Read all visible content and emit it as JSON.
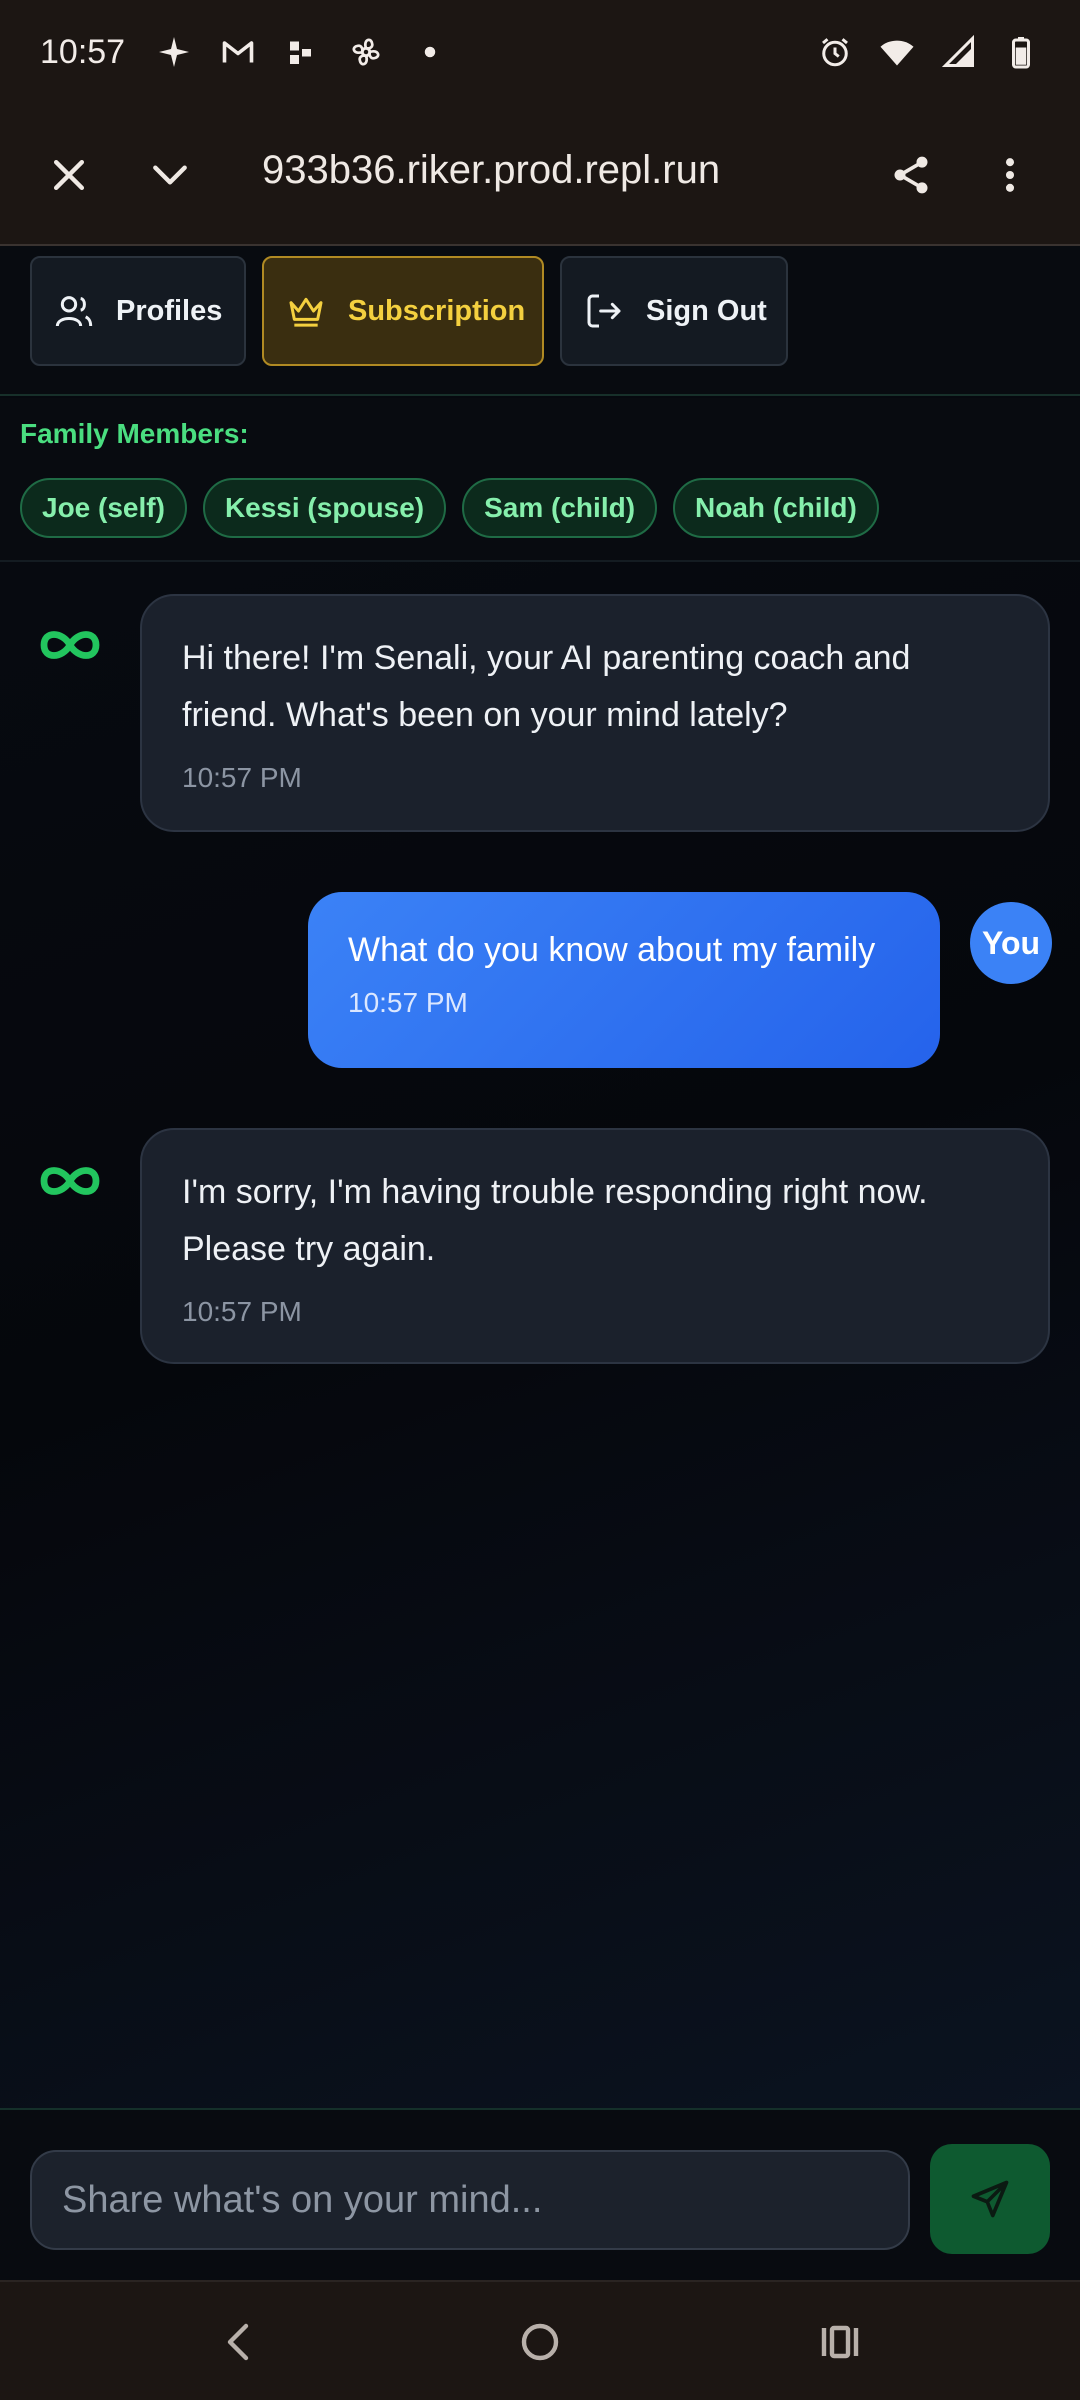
{
  "status_bar": {
    "time": "10:57",
    "left_icons": [
      "sparkle-icon",
      "gmail-icon",
      "dots-icon",
      "fan-icon",
      "dot-icon"
    ],
    "right_icons": [
      "alarm-icon",
      "wifi-icon",
      "signal-icon",
      "battery-icon"
    ]
  },
  "browser": {
    "url": "933b36.riker.prod.repl.run",
    "icons": [
      "close-icon",
      "chevron-down-icon",
      "share-icon",
      "more-vert-icon"
    ]
  },
  "nav": {
    "profiles_label": "Profiles",
    "subscription_label": "Subscription",
    "signout_label": "Sign Out"
  },
  "family": {
    "label": "Family Members:",
    "members": [
      "Joe (self)",
      "Kessi (spouse)",
      "Sam (child)",
      "Noah (child)"
    ]
  },
  "messages": [
    {
      "sender": "bot",
      "text": "Hi there! I'm Senali, your AI parenting coach and friend. What's been on your mind lately?",
      "time": "10:57 PM"
    },
    {
      "sender": "user",
      "avatar_label": "You",
      "text": "What do you know about my family",
      "time": "10:57 PM"
    },
    {
      "sender": "bot",
      "text": "I'm sorry, I'm having trouble responding right now. Please try again.",
      "time": "10:57 PM"
    }
  ],
  "composer": {
    "placeholder": "Share what's on your mind...",
    "send_icon": "send-icon"
  },
  "colors": {
    "accent_green": "#4ade80",
    "user_bubble": "#3b82f6",
    "subscription_gold": "#f4d03f"
  }
}
